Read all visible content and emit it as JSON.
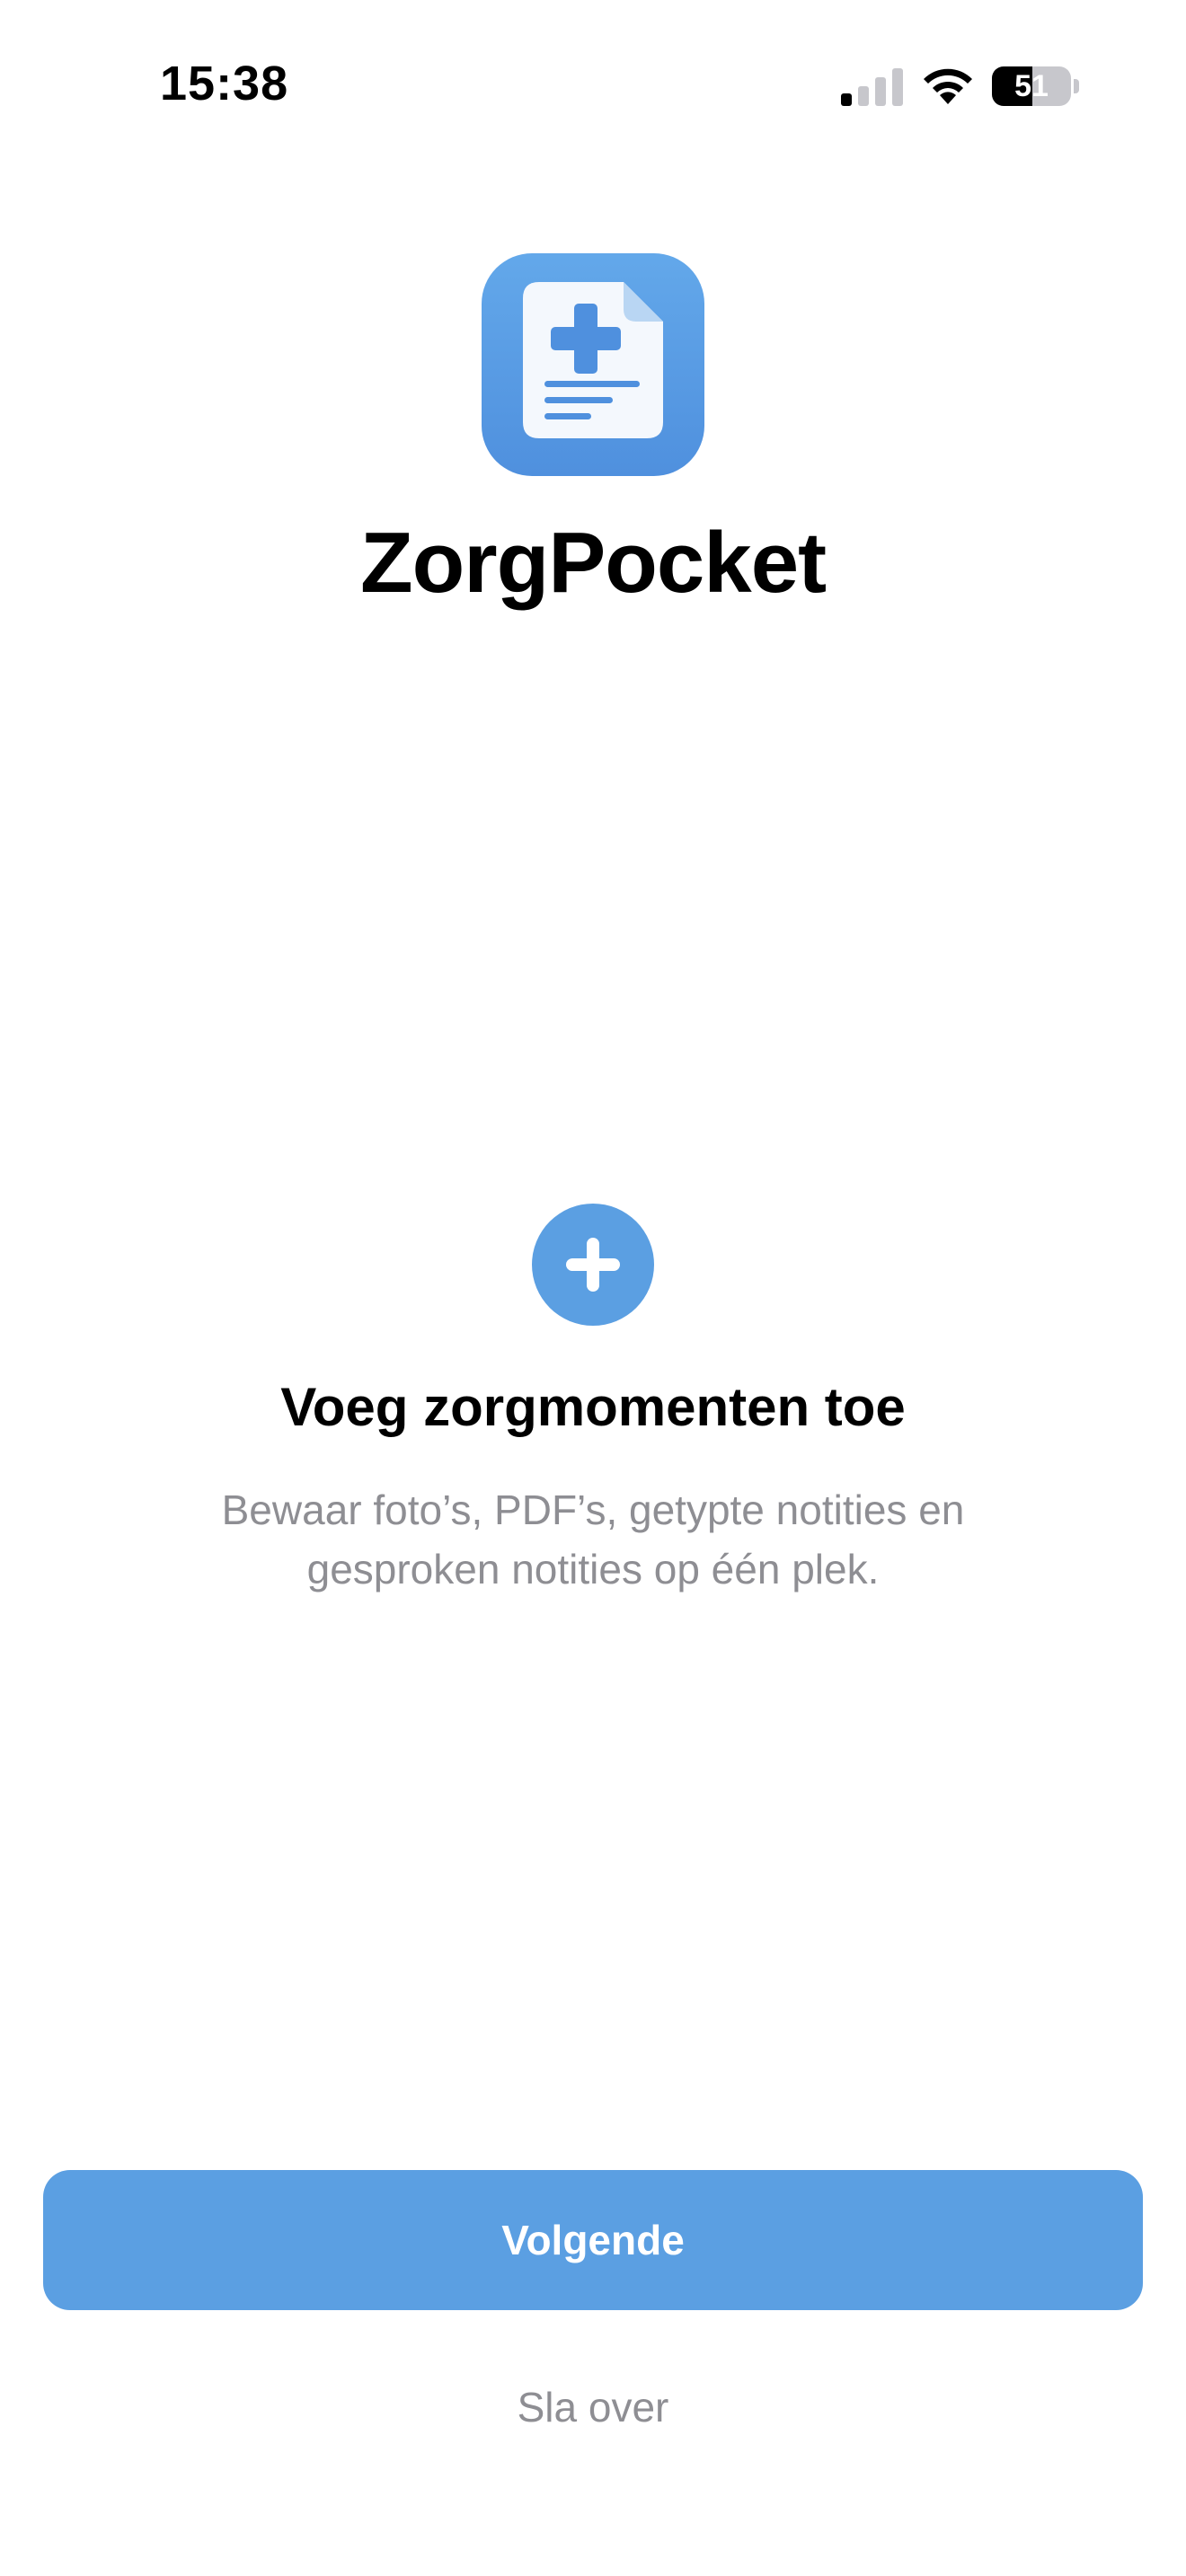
{
  "status_bar": {
    "time": "15:38",
    "battery_level": "51",
    "battery_fraction": 0.51,
    "signal_bars_active": 1,
    "signal_bars_total": 4
  },
  "app": {
    "name": "ZorgPocket",
    "logo_icon": "medical-document-icon"
  },
  "feature": {
    "icon": "plus-circle-icon",
    "title": "Voeg zorgmomenten toe",
    "description": "Bewaar foto’s, PDF’s, getypte notities en gesproken notities op één plek."
  },
  "actions": {
    "next_label": "Volgende",
    "skip_label": "Sla over"
  },
  "colors": {
    "accent": "#5B9FE2",
    "secondary_text": "#8E8E93",
    "background": "#FFFFFF"
  }
}
